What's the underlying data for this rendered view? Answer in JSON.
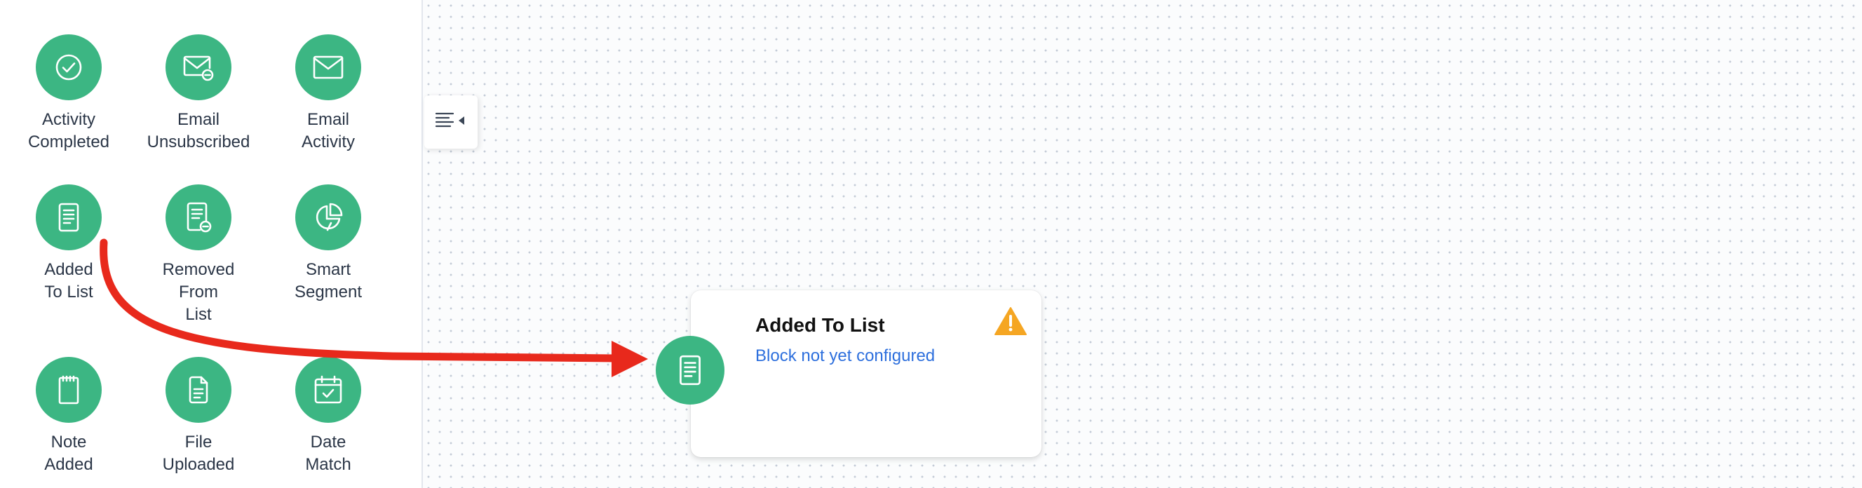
{
  "sidebar": {
    "blocks": [
      {
        "label": "Activity\nCompleted",
        "icon": "check-circle-icon"
      },
      {
        "label": "Email\nUnsubscribed",
        "icon": "email-minus-icon"
      },
      {
        "label": "Email\nActivity",
        "icon": "email-icon"
      },
      {
        "label": "Added\nTo List",
        "icon": "list-document-icon"
      },
      {
        "label": "Removed\nFrom\nList",
        "icon": "list-document-minus-icon"
      },
      {
        "label": "Smart\nSegment",
        "icon": "pie-chart-icon"
      },
      {
        "label": "Note\nAdded",
        "icon": "notepad-icon"
      },
      {
        "label": "File\nUploaded",
        "icon": "file-icon"
      },
      {
        "label": "Date\nMatch",
        "icon": "calendar-check-icon"
      }
    ]
  },
  "toggle": {
    "icon": "align-left-collapse-icon"
  },
  "node": {
    "title": "Added To List",
    "status": "Block not yet configured",
    "icon": "list-document-icon",
    "warning_icon": "warning-triangle-icon"
  },
  "colors": {
    "block_green": "#3cb683",
    "status_blue": "#2d6fdd",
    "warning_orange": "#f5a623",
    "arrow_red": "#e8291c"
  }
}
